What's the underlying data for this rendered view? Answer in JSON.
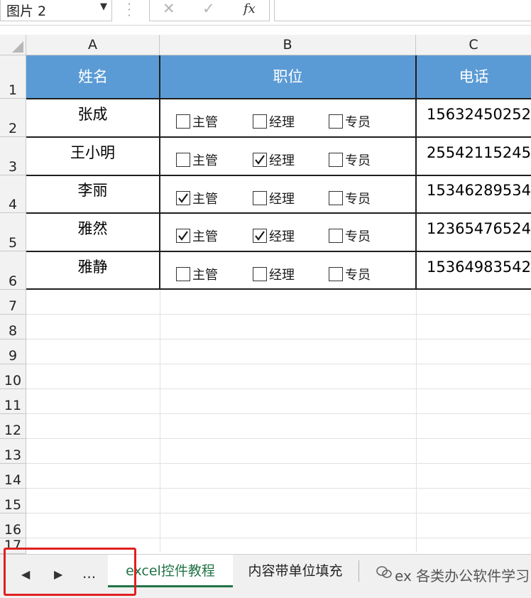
{
  "formula_bar": {
    "name_box": "图片 2",
    "cancel_glyph": "✕",
    "confirm_glyph": "✓",
    "fx_glyph": "fx"
  },
  "columns": [
    "A",
    "B",
    "C"
  ],
  "row_numbers": [
    "1",
    "2",
    "3",
    "4",
    "5",
    "6",
    "7",
    "8",
    "9",
    "10",
    "11",
    "12",
    "13",
    "14",
    "15",
    "16",
    "17"
  ],
  "table": {
    "headers": [
      "姓名",
      "职位",
      "电话"
    ],
    "position_options": [
      "主管",
      "经理",
      "专员"
    ],
    "rows": [
      {
        "name": "张成",
        "checks": [
          false,
          false,
          false
        ],
        "phone": "15632450252"
      },
      {
        "name": "王小明",
        "checks": [
          false,
          true,
          false
        ],
        "phone": "25542115245"
      },
      {
        "name": "李丽",
        "checks": [
          true,
          false,
          false
        ],
        "phone": "15346289534"
      },
      {
        "name": "雅然",
        "checks": [
          true,
          true,
          false
        ],
        "phone": "12365476524"
      },
      {
        "name": "雅静",
        "checks": [
          false,
          false,
          false
        ],
        "phone": "15364983542"
      }
    ]
  },
  "sheet_tabs": {
    "nav_prev": "◀",
    "nav_next": "▶",
    "nav_more": "...",
    "tabs": [
      "excel控件教程",
      "内容带单位填充"
    ],
    "active_index": 0,
    "watermark": "ex 各类办公软件学习 te"
  },
  "colors": {
    "header_fill": "#5b9bd5",
    "active_tab": "#217346",
    "highlight_box": "#e02020"
  }
}
